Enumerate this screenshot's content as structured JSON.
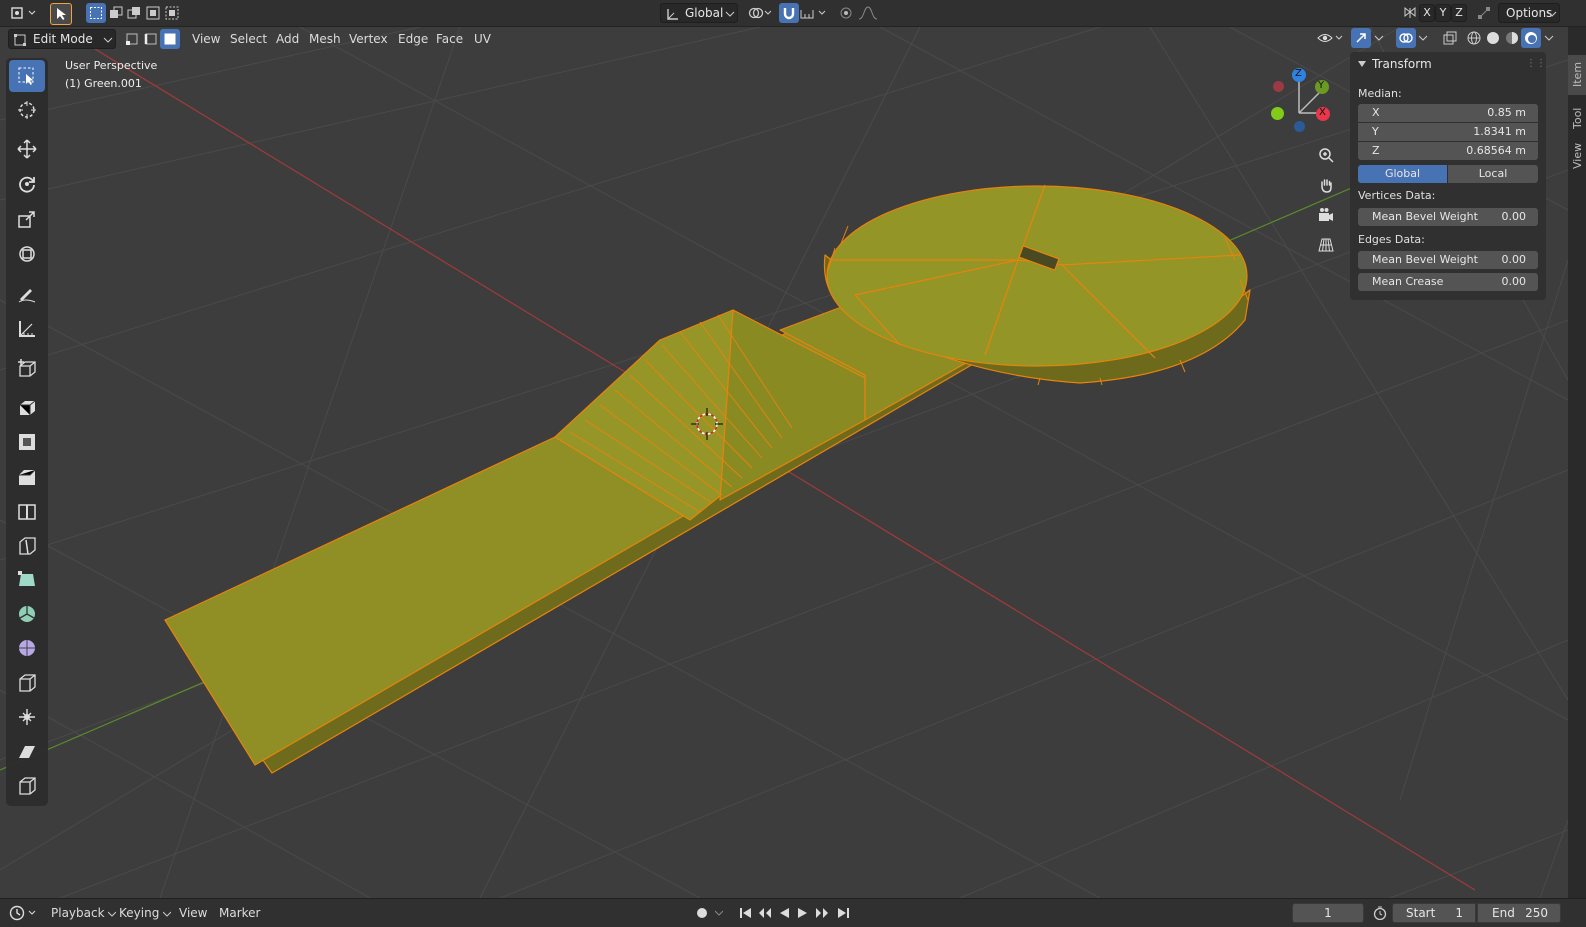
{
  "header": {
    "orientation": "Global",
    "axes": [
      "X",
      "Y",
      "Z"
    ],
    "options_label": "Options"
  },
  "mode_bar": {
    "mode": "Edit Mode",
    "menus": [
      "View",
      "Select",
      "Add",
      "Mesh",
      "Vertex",
      "Edge",
      "Face",
      "UV"
    ]
  },
  "viewport": {
    "view_name": "User Perspective",
    "object_name": "(1) Green.001"
  },
  "gizmo": {
    "x_label": "X",
    "y_label": "Y",
    "z_label": "Z",
    "colors": {
      "x": "#e8364a",
      "y": "#6a9a24",
      "z": "#2f83e0"
    }
  },
  "npanel": {
    "title": "Transform",
    "median_label": "Median:",
    "x_label": "X",
    "x_value": "0.85 m",
    "y_label": "Y",
    "y_value": "1.8341 m",
    "z_label": "Z",
    "z_value": "0.68564 m",
    "global_label": "Global",
    "local_label": "Local",
    "vertices_data_label": "Vertices Data:",
    "vert_bevel_label": "Mean Bevel Weight",
    "vert_bevel_value": "0.00",
    "edges_data_label": "Edges Data:",
    "edge_bevel_label": "Mean Bevel Weight",
    "edge_bevel_value": "0.00",
    "crease_label": "Mean Crease",
    "crease_value": "0.00"
  },
  "side_tabs": [
    "Item",
    "Tool",
    "View"
  ],
  "timeline": {
    "menus": [
      "Playback",
      "Keying",
      "View",
      "Marker"
    ],
    "current_frame": "1",
    "start_label": "Start",
    "start_value": "1",
    "end_label": "End",
    "end_value": "250"
  },
  "colors": {
    "accent": "#4772b3",
    "mesh_fill": "#8f8f25",
    "mesh_edge": "#e8830c",
    "axis_x": "#a23a3a",
    "axis_y": "#5c8a2a"
  }
}
